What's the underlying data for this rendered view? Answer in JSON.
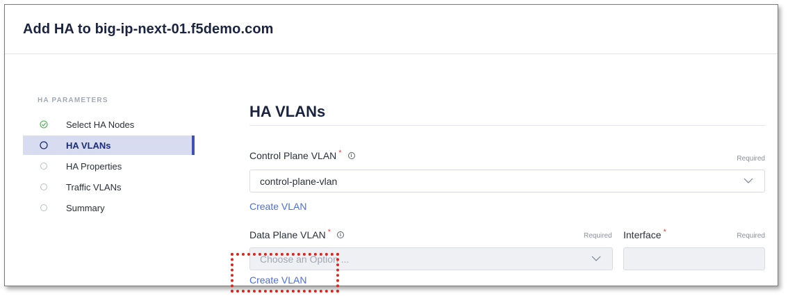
{
  "header": {
    "title": "Add HA to big-ip-next-01.f5demo.com"
  },
  "sidebar": {
    "section_title": "HA PARAMETERS",
    "items": [
      {
        "label": "Select HA Nodes",
        "state": "completed",
        "icon": "check-circle-icon"
      },
      {
        "label": "HA VLANs",
        "state": "active",
        "icon": "circle-outline-icon"
      },
      {
        "label": "HA Properties",
        "state": "pending",
        "icon": "circle-outline-icon"
      },
      {
        "label": "Traffic VLANs",
        "state": "pending",
        "icon": "circle-outline-icon"
      },
      {
        "label": "Summary",
        "state": "pending",
        "icon": "circle-outline-icon"
      }
    ]
  },
  "main": {
    "heading": "HA VLANs",
    "control_plane": {
      "label": "Control Plane VLAN",
      "required_mark": "*",
      "required_text": "Required",
      "value": "control-plane-vlan",
      "create_link": "Create VLAN"
    },
    "data_plane": {
      "label": "Data Plane VLAN",
      "required_mark": "*",
      "required_text": "Required",
      "placeholder": "Choose an Option ...",
      "create_link": "Create VLAN"
    },
    "interface": {
      "label": "Interface",
      "required_mark": "*",
      "required_text": "Required",
      "value": ""
    },
    "info_glyph": "i"
  },
  "colors": {
    "accent": "#3f51b5",
    "link": "#4a6fdc",
    "required": "#e0413a",
    "success": "#4caf50",
    "highlight_box": "#e0241b"
  }
}
